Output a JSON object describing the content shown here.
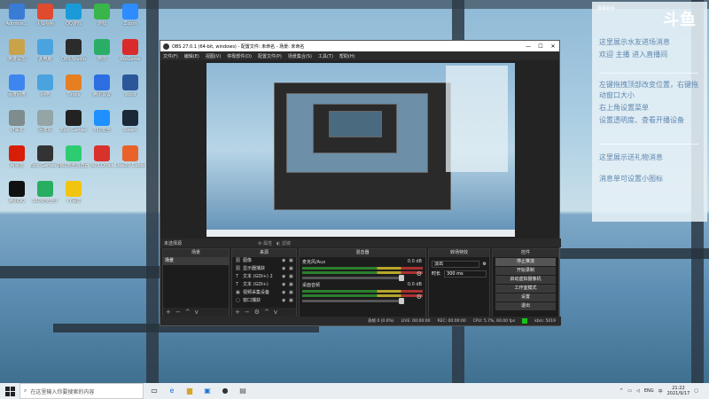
{
  "desktop": {
    "icons": [
      {
        "label": "Adminis...",
        "color": "#3a7bd5"
      },
      {
        "label": "火狐视频",
        "color": "#e04a2f"
      },
      {
        "label": "QQ游戏",
        "color": "#1a9bd7"
      },
      {
        "label": "游戏",
        "color": "#39b54a"
      },
      {
        "label": "Zoom",
        "color": "#2d8cff"
      },
      {
        "label": "英雄联盟",
        "color": "#c9a34a"
      },
      {
        "label": "此电脑",
        "color": "#4aa3df"
      },
      {
        "label": "OBS Studio",
        "color": "#2b2b2b"
      },
      {
        "label": "微信",
        "color": "#2aae67"
      },
      {
        "label": "WeGame",
        "color": "#d92b2b"
      },
      {
        "label": "百度网盘",
        "color": "#3d86f0"
      },
      {
        "label": "网络",
        "color": "#4aa3df"
      },
      {
        "label": "Tingle",
        "color": "#e67e22"
      },
      {
        "label": "腾讯会议",
        "color": "#2d6fe0"
      },
      {
        "label": "Word",
        "color": "#2b579a"
      },
      {
        "label": "记事本",
        "color": "#7f8c8d"
      },
      {
        "label": "回收站",
        "color": "#95a5a6"
      },
      {
        "label": "Epic Games",
        "color": "#222222"
      },
      {
        "label": "360安全",
        "color": "#1e90ff"
      },
      {
        "label": "Steam",
        "color": "#1b2838"
      },
      {
        "label": "网易云",
        "color": "#d81e06"
      },
      {
        "label": "Epic Games Launcher",
        "color": "#333333"
      },
      {
        "label": "360安全浏览器",
        "color": "#2ecc71"
      },
      {
        "label": "WPS Office",
        "color": "#d9312c"
      },
      {
        "label": "Live2D Cubism",
        "color": "#e8622a"
      },
      {
        "label": "腾讯QQ",
        "color": "#111111"
      },
      {
        "label": "360安全卫士",
        "color": "#27ae60"
      },
      {
        "label": "YY语音",
        "color": "#f1c40f"
      }
    ]
  },
  "obs": {
    "title": "OBS 27.0.1 (64-bit, windows) - 配置文件: 未命名 - 场景: 未命名",
    "menu": [
      "文件(F)",
      "编辑(E)",
      "视图(V)",
      "停靠部件(D)",
      "配置文件(P)",
      "场景集合(S)",
      "工具(T)",
      "帮助(H)"
    ],
    "selected_source_label": "未选择源",
    "props_label": "属性",
    "filters_label": "滤镜",
    "panels": {
      "scenes": {
        "header": "场景",
        "items": [
          "场景"
        ]
      },
      "sources": {
        "header": "来源",
        "items": [
          {
            "type": "图",
            "name": "图像"
          },
          {
            "type": "图",
            "name": "显示器捕获"
          },
          {
            "type": "T",
            "name": "文本 (GDI+) 2"
          },
          {
            "type": "T",
            "name": "文本 (GDI+)"
          },
          {
            "type": "▣",
            "name": "视频采集设备"
          },
          {
            "type": "▢",
            "name": "窗口捕获"
          }
        ]
      },
      "mixer": {
        "header": "混音器",
        "channels": [
          {
            "name": "麦克风/Aux",
            "db": "0.0 dB"
          },
          {
            "name": "桌面音频",
            "db": "0.0 dB"
          }
        ]
      },
      "transitions": {
        "header": "转场特效",
        "type": "淡出",
        "duration_label": "时长",
        "duration": "300 ms"
      },
      "controls": {
        "header": "控件",
        "buttons": [
          "停止推流",
          "开始录制",
          "启动虚拟摄像机",
          "工作室模式",
          "设置",
          "退出"
        ]
      }
    },
    "status": {
      "dropped": "丢帧 0 (0.0%)",
      "live": "LIVE: 00:00:00",
      "rec": "REC: 00:00:00",
      "cpu": "CPU: 5.7%, 60.00 fps",
      "kbps": "kb/s: 5019"
    }
  },
  "chat": {
    "title": "弹幕助手",
    "brand": "斗鱼",
    "messages": [
      "这里展示水友进场消息",
      "欢迎 主播 进入直播间",
      "左键拖拽顶部改变位置，右键拖",
      "动窗口大小",
      "右上角设置菜单",
      "设置透明度、查看开播设备",
      "这里展示送礼物消息",
      "消息单可设置小图标"
    ]
  },
  "taskbar": {
    "search_placeholder": "在这里输入你要搜索的内容",
    "lang": "ENG",
    "time": "21:22",
    "date": "2021/9/17"
  }
}
